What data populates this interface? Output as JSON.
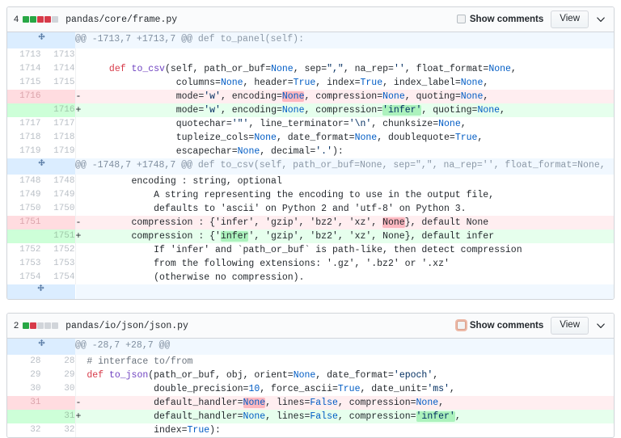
{
  "colors": {
    "add_bg": "#e6ffed",
    "del_bg": "#ffeef0",
    "add_word": "#acf2bd",
    "del_word": "#fdb8c0",
    "hunk_bg": "#f1f8ff",
    "stat_add": "#28a745",
    "stat_del": "#d73a49",
    "stat_neutral": "#d1d5da"
  },
  "files": [
    {
      "change_count": "4",
      "diffstat": [
        "add",
        "add",
        "del",
        "del",
        "neutral"
      ],
      "path": "pandas/core/frame.py",
      "show_comments_label": "Show comments",
      "show_comments_checked": false,
      "show_comments_focused": false,
      "view_label": "View",
      "chevron_icon": "chevron-down-icon",
      "expander_icon": "unfold-icon",
      "hunks": [
        {
          "header_range": "@@ -1713,7 +1713,7 @@",
          "header_context": "def to_panel(self):",
          "rows": [
            {
              "type": "ctx",
              "old": "1713",
              "new": "1713",
              "marker": "",
              "code": ""
            },
            {
              "type": "ctx",
              "old": "1714",
              "new": "1714",
              "marker": "",
              "code": "    def to_csv(self, path_or_buf=None, sep=\",\", na_rep='', float_format=None,"
            },
            {
              "type": "ctx",
              "old": "1715",
              "new": "1715",
              "marker": "",
              "code": "                columns=None, header=True, index=True, index_label=None,"
            },
            {
              "type": "del",
              "old": "1716",
              "new": "",
              "marker": "-",
              "code": "                mode='w', encoding=None, compression=None, quoting=None,"
            },
            {
              "type": "add",
              "old": "",
              "new": "1716",
              "marker": "+",
              "code": "                mode='w', encoding=None, compression='infer', quoting=None,"
            },
            {
              "type": "ctx",
              "old": "1717",
              "new": "1717",
              "marker": "",
              "code": "                quotechar='\"', line_terminator='\\n', chunksize=None,"
            },
            {
              "type": "ctx",
              "old": "1718",
              "new": "1718",
              "marker": "",
              "code": "                tupleize_cols=None, date_format=None, doublequote=True,"
            },
            {
              "type": "ctx",
              "old": "1719",
              "new": "1719",
              "marker": "",
              "code": "                escapechar=None, decimal='.'):"
            }
          ]
        },
        {
          "header_range": "@@ -1748,7 +1748,7 @@",
          "header_context": "def to_csv(self, path_or_buf=None, sep=\",\", na_rep='', float_format=None,",
          "rows": [
            {
              "type": "ctx",
              "old": "1748",
              "new": "1748",
              "marker": "",
              "code": "        encoding : string, optional"
            },
            {
              "type": "ctx",
              "old": "1749",
              "new": "1749",
              "marker": "",
              "code": "            A string representing the encoding to use in the output file,"
            },
            {
              "type": "ctx",
              "old": "1750",
              "new": "1750",
              "marker": "",
              "code": "            defaults to 'ascii' on Python 2 and 'utf-8' on Python 3."
            },
            {
              "type": "del",
              "old": "1751",
              "new": "",
              "marker": "-",
              "code": "        compression : {'infer', 'gzip', 'bz2', 'xz', None}, default None"
            },
            {
              "type": "add",
              "old": "",
              "new": "1751",
              "marker": "+",
              "code": "        compression : {'infer', 'gzip', 'bz2', 'xz', None}, default infer"
            },
            {
              "type": "ctx",
              "old": "1752",
              "new": "1752",
              "marker": "",
              "code": "            If 'infer' and `path_or_buf` is path-like, then detect compression"
            },
            {
              "type": "ctx",
              "old": "1753",
              "new": "1753",
              "marker": "",
              "code": "            from the following extensions: '.gz', '.bz2' or '.xz'"
            },
            {
              "type": "ctx",
              "old": "1754",
              "new": "1754",
              "marker": "",
              "code": "            (otherwise no compression)."
            }
          ]
        }
      ],
      "has_bottom_expander": true
    },
    {
      "change_count": "2",
      "diffstat": [
        "add",
        "del",
        "neutral",
        "neutral",
        "neutral"
      ],
      "path": "pandas/io/json/json.py",
      "show_comments_label": "Show comments",
      "show_comments_checked": false,
      "show_comments_focused": true,
      "view_label": "View",
      "chevron_icon": "chevron-down-icon",
      "expander_icon": "unfold-icon",
      "hunks": [
        {
          "header_range": "@@ -28,7 +28,7 @@",
          "header_context": "",
          "rows": [
            {
              "type": "ctx",
              "old": "28",
              "new": "28",
              "marker": "",
              "code": "# interface to/from"
            },
            {
              "type": "ctx",
              "old": "29",
              "new": "29",
              "marker": "",
              "code": "def to_json(path_or_buf, obj, orient=None, date_format='epoch',"
            },
            {
              "type": "ctx",
              "old": "30",
              "new": "30",
              "marker": "",
              "code": "            double_precision=10, force_ascii=True, date_unit='ms',"
            },
            {
              "type": "del",
              "old": "31",
              "new": "",
              "marker": "-",
              "code": "            default_handler=None, lines=False, compression=None,"
            },
            {
              "type": "add",
              "old": "",
              "new": "31",
              "marker": "+",
              "code": "            default_handler=None, lines=False, compression='infer',"
            },
            {
              "type": "ctx",
              "old": "32",
              "new": "32",
              "marker": "",
              "code": "            index=True):"
            }
          ]
        }
      ],
      "has_bottom_expander": false
    }
  ]
}
